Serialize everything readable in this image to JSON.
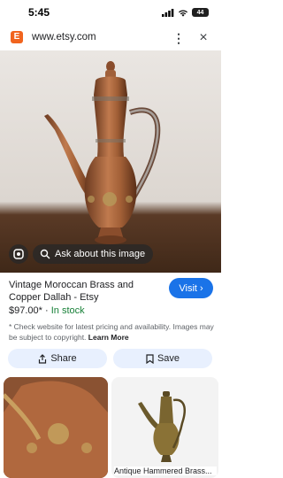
{
  "status_bar": {
    "time": "5:45",
    "battery": "44",
    "icons": [
      "signal-icon",
      "wifi-icon",
      "battery-icon"
    ]
  },
  "url_bar": {
    "favicon_letter": "E",
    "url": "www.etsy.com",
    "menu_label": "⋮",
    "close_label": "×"
  },
  "hero": {
    "ask_label": "Ask about this image"
  },
  "result": {
    "title": "Vintage Moroccan Brass and Copper Dallah - Etsy",
    "visit_label": "Visit",
    "price": "$97.00*",
    "separator": " · ",
    "stock": "In stock",
    "disclaimer": "* Check website for latest pricing and availability. Images may be subject to copyright.",
    "learn_more": "Learn More"
  },
  "actions": {
    "share_label": "Share",
    "save_label": "Save"
  },
  "related": {
    "right_caption": "Antique Hammered Brass..."
  },
  "colors": {
    "accent": "#1a73e8",
    "stock": "#188038",
    "chip_bg": "#e8f0fe",
    "etsy_orange": "#f1641e"
  }
}
